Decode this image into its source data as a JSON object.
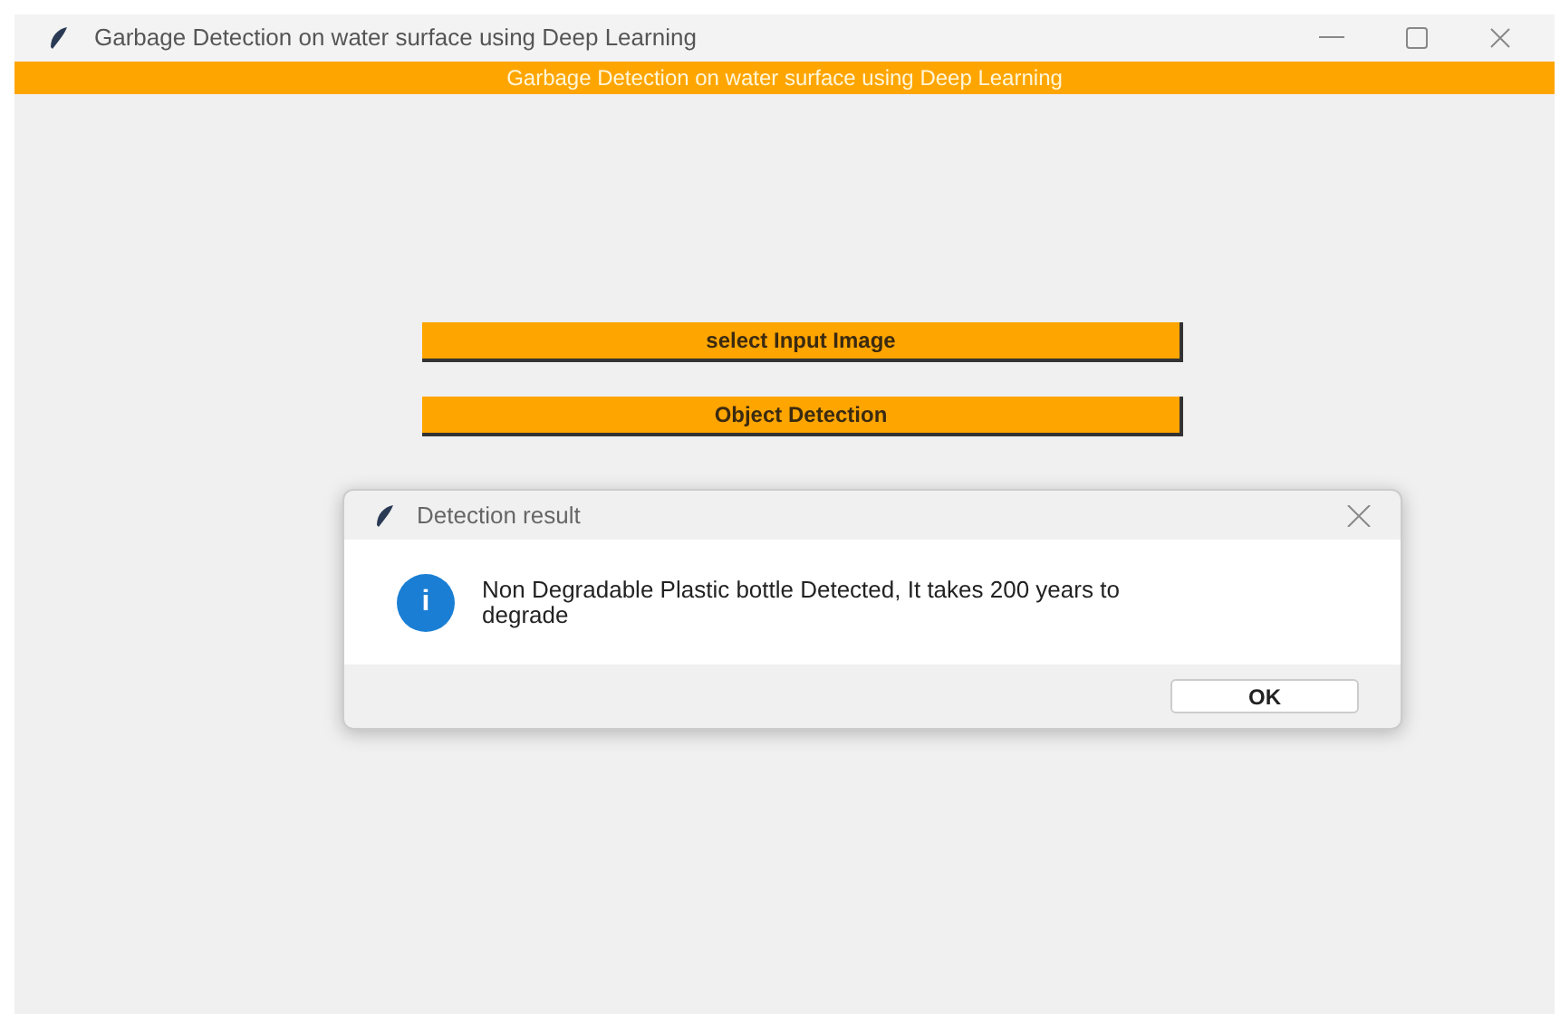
{
  "window": {
    "title": "Garbage Detection on water surface using Deep Learning"
  },
  "banner": "Garbage Detection on water surface using Deep Learning",
  "buttons": [
    "select Input Image",
    "Object Detection"
  ],
  "dialog": {
    "title": "Detection result",
    "icon": "i",
    "message": "Non Degradable Plastic bottle Detected, It takes 200 years to degrade",
    "button": "OK"
  }
}
